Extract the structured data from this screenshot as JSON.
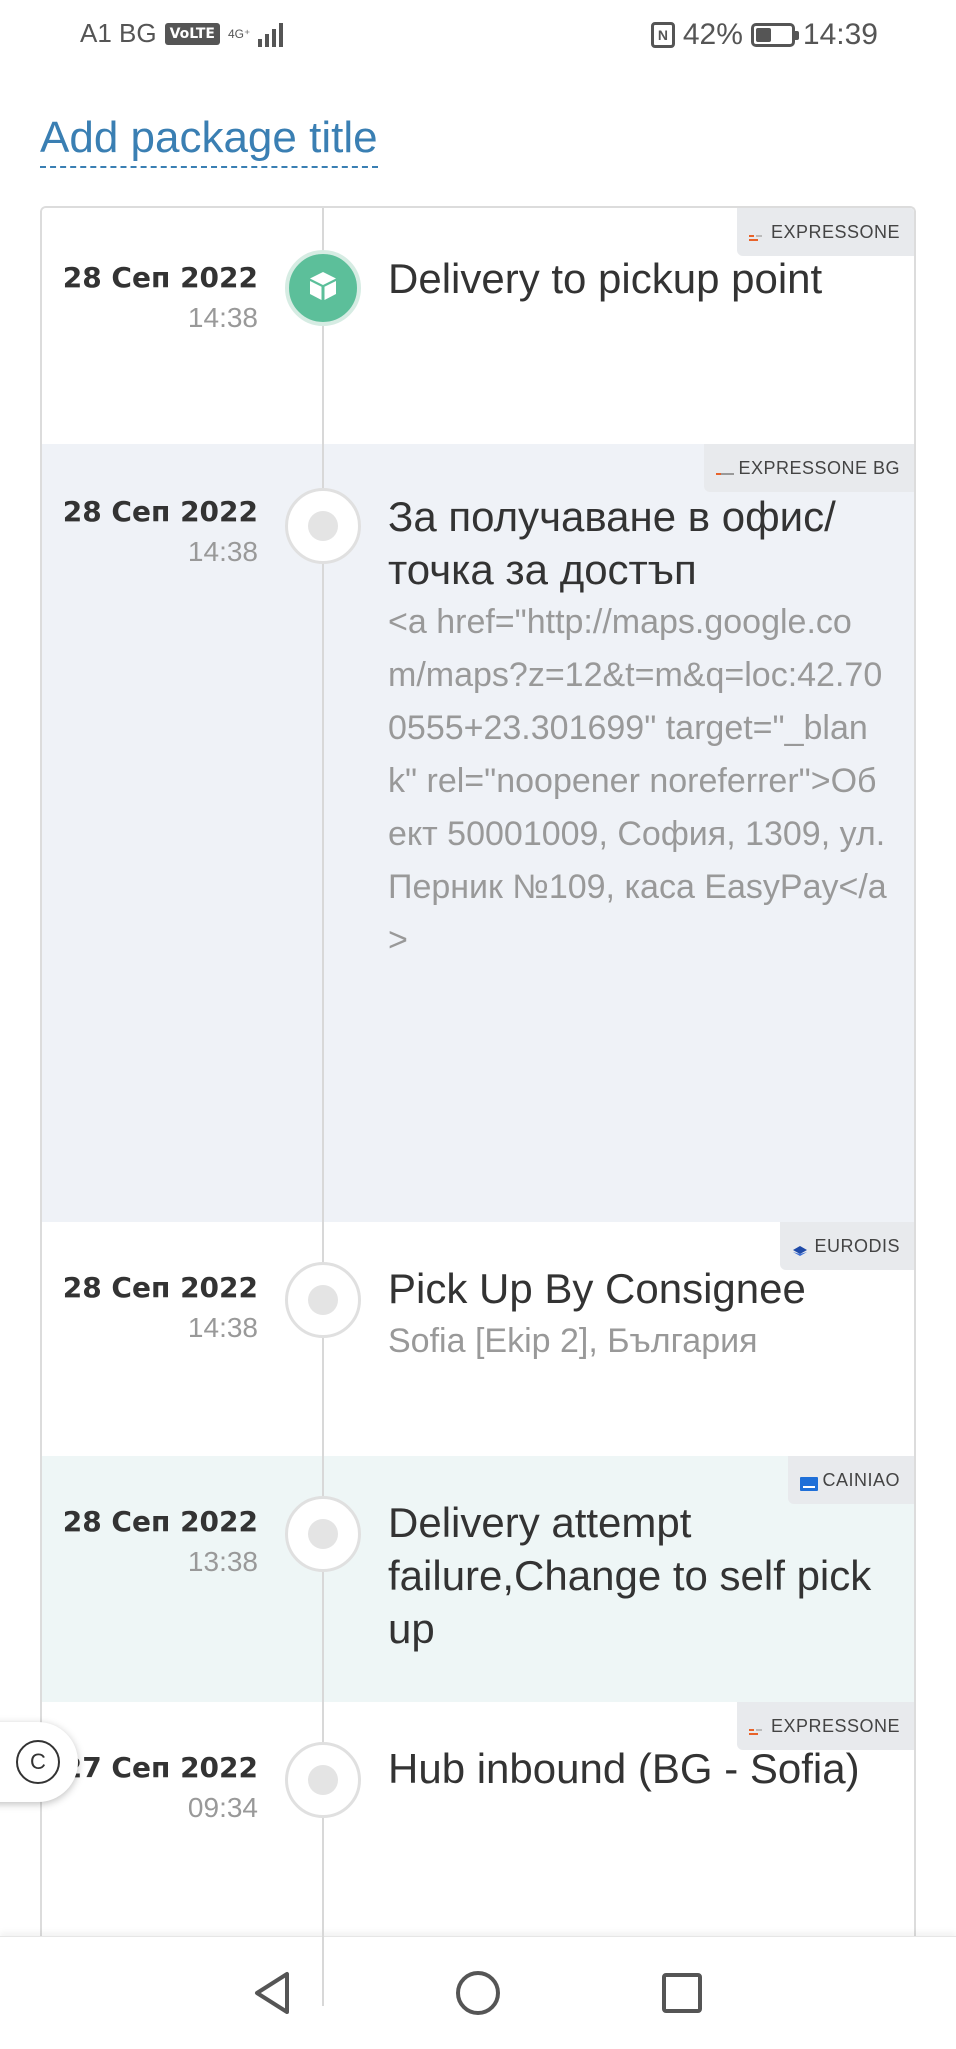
{
  "status_bar": {
    "carrier": "A1 BG",
    "volte": "VoLTE",
    "network": "4G⁺",
    "battery_percent": "42%",
    "battery_level": 0.42,
    "time": "14:39",
    "nfc": "N"
  },
  "package_title": "Add package title",
  "events": [
    {
      "carrier": "EXPRESSONE",
      "date": "28 Сеп 2022",
      "time": "14:38",
      "title": "Delivery to pickup point",
      "description": "",
      "icon": "package-icon",
      "active": true
    },
    {
      "carrier": "EXPRESSONE BG",
      "date": "28 Сеп 2022",
      "time": "14:38",
      "title": "За получаване в офис/ точка за достъп",
      "description": "<a href=\"http://maps.google.com/maps?z=12&t=m&q=loc:42.700555+23.301699\" target=\"_blank\" rel=\"noopener noreferrer\">Обект 50001009, София, 1309, ул. Перник №109, каса EasyPay</a>",
      "active": false
    },
    {
      "carrier": "EURODIS",
      "date": "28 Сеп 2022",
      "time": "14:38",
      "title": "Pick Up By Consignee",
      "description": "Sofia [Ekip 2], България",
      "active": false
    },
    {
      "carrier": "CAINIAO",
      "date": "28 Сеп 2022",
      "time": "13:38",
      "title": "Delivery attempt failure,Change to self pick up",
      "description": "",
      "active": false
    },
    {
      "carrier": "EXPRESSONE",
      "date": "27 Сеп 2022",
      "time": "09:34",
      "title": "Hub inbound (BG - Sofia)",
      "description": "",
      "active": false
    }
  ],
  "float_button": {
    "label": "C"
  },
  "colors": {
    "accent": "#3a7fb3",
    "active_node": "#5cbf9a",
    "event_bg_blue": "#eff2f7",
    "event_bg_mint": "#eef6f6"
  }
}
